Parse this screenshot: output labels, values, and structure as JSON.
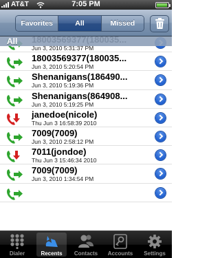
{
  "status_bar": {
    "carrier": "AT&T",
    "time": "7:05 PM",
    "signal_icon": "signal-bars-icon",
    "wifi_icon": "wifi-icon",
    "battery_icon": "battery-icon"
  },
  "toolbar": {
    "segments": [
      "Favorites",
      "All",
      "Missed"
    ],
    "selected_segment": "All",
    "trash_icon": "trash-icon"
  },
  "list": {
    "section_header": "All",
    "rows": [
      {
        "name": "18003569377(180035...",
        "date": "Jun 3, 2010 5:31:37 PM",
        "type": "outgoing"
      },
      {
        "name": "18003569377(180035...",
        "date": "Jun 3, 2010 5:20:54 PM",
        "type": "outgoing"
      },
      {
        "name": "Shenanigans(186490...",
        "date": "Jun 3, 2010 5:19:36 PM",
        "type": "outgoing"
      },
      {
        "name": "Shenanigans(864908...",
        "date": "Jun 3, 2010 5:19:25 PM",
        "type": "outgoing"
      },
      {
        "name": "janedoe(nicole)",
        "date": "Thu Jun  3 16:58:39 2010",
        "type": "missed"
      },
      {
        "name": "7009(7009)",
        "date": "Jun 3, 2010 2:58:12 PM",
        "type": "outgoing"
      },
      {
        "name": "7011(jondoe)",
        "date": "Thu Jun  3 15:46:34 2010",
        "type": "incoming"
      },
      {
        "name": "7009(7009)",
        "date": "Jun 3, 2010 1:34:54 PM",
        "type": "outgoing"
      },
      {
        "name": "",
        "date": "",
        "type": "outgoing"
      }
    ]
  },
  "tab_bar": {
    "tabs": [
      {
        "label": "Dialer",
        "icon": "keypad-icon"
      },
      {
        "label": "Recents",
        "icon": "recents-icon"
      },
      {
        "label": "Contacts",
        "icon": "contacts-icon"
      },
      {
        "label": "Accounts",
        "icon": "accounts-icon"
      },
      {
        "label": "Settings",
        "icon": "gear-icon"
      }
    ],
    "active_tab": "Recents"
  },
  "colors": {
    "outgoing": "#2ea52e",
    "incoming": "#2ea52e",
    "missed": "#d42020",
    "accent": "#2b4f86",
    "disclosure": "#1f5fcf"
  }
}
